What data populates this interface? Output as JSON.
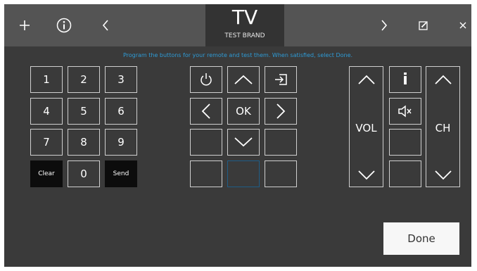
{
  "header": {
    "title": "TV",
    "brand": "TEST BRAND",
    "icons": [
      "plus-icon",
      "info-icon",
      "chevron-left-icon",
      "chevron-right-icon",
      "edit-icon",
      "close-icon"
    ]
  },
  "hint": "Program the buttons for your remote and test them. When satisfied, select Done.",
  "keypad": {
    "digits": [
      "1",
      "2",
      "3",
      "4",
      "5",
      "6",
      "7",
      "8",
      "9"
    ],
    "clear": "Clear",
    "zero": "0",
    "send": "Send"
  },
  "nav": {
    "ok": "OK"
  },
  "side": {
    "vol": "VOL",
    "ch": "CH",
    "info": "i"
  },
  "done": "Done",
  "colors": {
    "accent": "#2e9bd6",
    "background": "#3a3a3a",
    "header": "#545454",
    "title_bg": "#333333"
  }
}
